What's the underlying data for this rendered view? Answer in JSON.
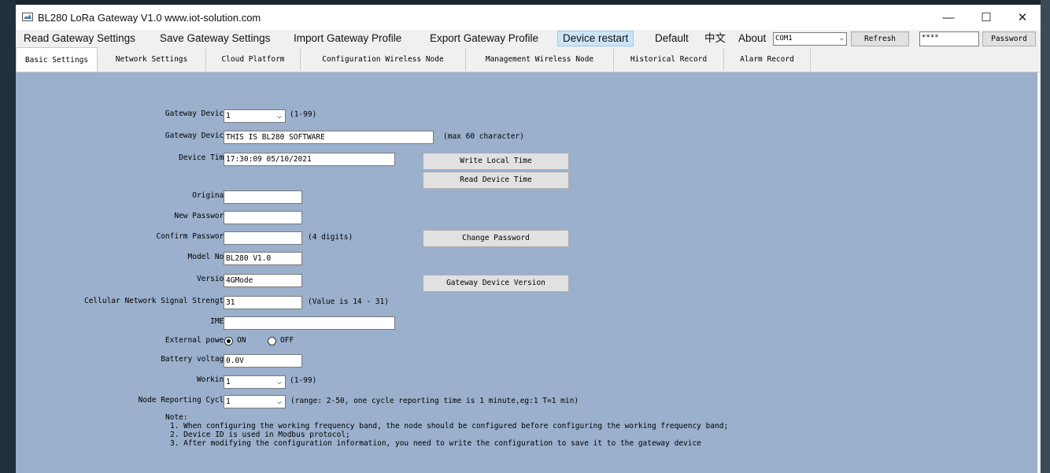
{
  "window": {
    "title": "BL280 LoRa Gateway V1.0 www.iot-solution.com",
    "minimize": "—",
    "maximize": "☐",
    "close": "✕"
  },
  "menu": {
    "items": [
      "Read Gateway Settings",
      "Save Gateway Settings",
      "Import Gateway Profile",
      "Export Gateway Profile",
      "Device restart",
      "Default",
      "中文",
      "About"
    ],
    "com_port": "COM1",
    "refresh": "Refresh",
    "password_value": "****",
    "password_button": "Password"
  },
  "tabs": [
    "Basic Settings",
    "Network Settings",
    "Cloud Platform",
    "Configuration Wireless Node",
    "Management Wireless Node",
    "Historical Record",
    "Alarm Record"
  ],
  "form": {
    "gateway_device_id_label": "Gateway Device",
    "gateway_device_id_value": "1",
    "gateway_device_id_hint": "(1-99)",
    "gateway_device_name_label": "Gateway Device",
    "gateway_device_name_value": "THIS IS BL280 SOFTWARE",
    "gateway_device_name_hint": "(max 60 character)",
    "device_time_label": "Device Time",
    "device_time_value": "17:30:09 05/10/2021",
    "write_local_time": "Write Local Time",
    "read_device_time": "Read Device Time",
    "original_label": "Original",
    "original_value": "",
    "new_password_label": "New Password",
    "new_password_value": "",
    "confirm_password_label": "Confirm Password",
    "confirm_password_value": "",
    "confirm_password_hint": "(4 digits)",
    "change_password": "Change Password",
    "model_label": "Model No.",
    "model_value": "BL280 V1.0",
    "version_label": "Version",
    "version_value": "4GMode",
    "gateway_device_version": "Gateway Device Version",
    "signal_label": "Cellular Network Signal Strength",
    "signal_value": "31",
    "signal_hint": "(Value is 14 - 31)",
    "imei_label": "IMEI",
    "imei_value": "",
    "external_power_label": "External power",
    "external_power_on": "ON",
    "external_power_off": "OFF",
    "external_power_selected": "ON",
    "battery_label": "Battery voltage",
    "battery_value": "0.0V",
    "working_label": "Working",
    "working_value": "1",
    "working_hint": "(1-99)",
    "cycle_label": "Node Reporting Cycle",
    "cycle_value": "1",
    "cycle_hint": "(range: 2-50, one cycle reporting time is 1 minute,eg:1 T=1 min)"
  },
  "notes": {
    "title": "Note:",
    "lines": [
      "1. When configuring the working frequency band, the node should be configured before configuring the working frequency band;",
      "2. Device ID is used in Modbus protocol;",
      "3. After modifying the configuration information, you need to write the configuration to save it to the gateway device"
    ]
  },
  "colors": {
    "panel_bg": "#9ab0cc",
    "menu_active": "#cce4f7"
  }
}
